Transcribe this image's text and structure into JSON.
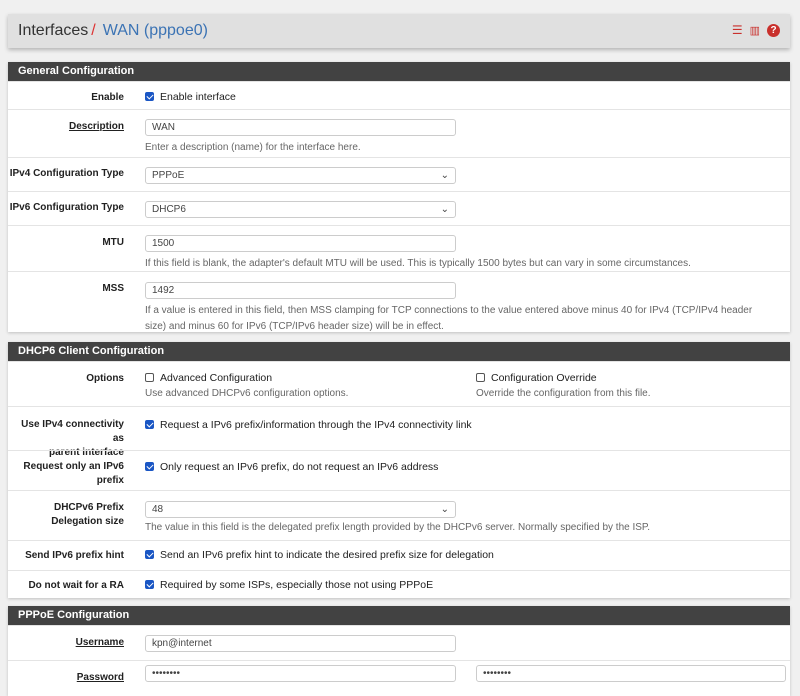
{
  "breadcrumb": {
    "parent": "Interfaces",
    "separator": "/",
    "current": "WAN (pppoe0)"
  },
  "header_icons": [
    "sliders-icon",
    "bar-chart-icon",
    "help-icon"
  ],
  "general": {
    "title": "General Configuration",
    "enable": {
      "label": "Enable",
      "checkbox": "Enable interface",
      "checked": true
    },
    "description": {
      "label": "Description",
      "value": "WAN",
      "help": "Enter a description (name) for the interface here."
    },
    "ipv4_type": {
      "label": "IPv4 Configuration Type",
      "value": "PPPoE"
    },
    "ipv6_type": {
      "label": "IPv6 Configuration Type",
      "value": "DHCP6"
    },
    "mtu": {
      "label": "MTU",
      "value": "1500",
      "help": "If this field is blank, the adapter's default MTU will be used. This is typically 1500 bytes but can vary in some circumstances."
    },
    "mss": {
      "label": "MSS",
      "value": "1492",
      "help": "If a value is entered in this field, then MSS clamping for TCP connections to the value entered above minus 40 for IPv4 (TCP/IPv4 header size) and minus 60 for IPv6 (TCP/IPv6 header size) will be in effect."
    }
  },
  "dhcp6": {
    "title": "DHCP6 Client Configuration",
    "options": {
      "label": "Options",
      "advanced": "Advanced Configuration",
      "advanced_help": "Use advanced DHCPv6 configuration options.",
      "override": "Configuration Override",
      "override_help": "Override the configuration from this file."
    },
    "ipv4_parent": {
      "label1": "Use IPv4 connectivity as",
      "label2": "parent interface",
      "checkbox": "Request a IPv6 prefix/information through the IPv4 connectivity link",
      "checked": true
    },
    "prefix_only": {
      "label1": "Request only an IPv6",
      "label2": "prefix",
      "checkbox": "Only request an IPv6 prefix, do not request an IPv6 address",
      "checked": true
    },
    "delegation": {
      "label1": "DHCPv6 Prefix",
      "label2": "Delegation size",
      "value": "48",
      "help": "The value in this field is the delegated prefix length provided by the DHCPv6 server. Normally specified by the ISP."
    },
    "hint": {
      "label": "Send IPv6 prefix hint",
      "checkbox": "Send an IPv6 prefix hint to indicate the desired prefix size for delegation",
      "checked": true
    },
    "no_wait_ra": {
      "label": "Do not wait for a RA",
      "checkbox": "Required by some ISPs, especially those not using PPPoE",
      "checked": true
    }
  },
  "pppoe": {
    "title": "PPPoE Configuration",
    "username": {
      "label": "Username",
      "value": "kpn@internet"
    },
    "password": {
      "label": "Password",
      "value": "••••••••",
      "confirm": "••••••••"
    }
  }
}
